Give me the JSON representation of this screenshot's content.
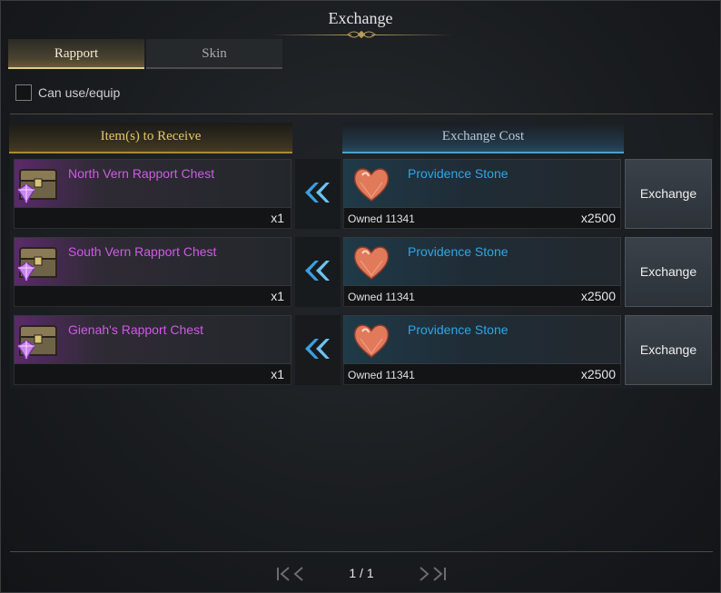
{
  "window": {
    "title": "Exchange"
  },
  "tabs": [
    {
      "label": "Rapport",
      "active": true
    },
    {
      "label": "Skin",
      "active": false
    }
  ],
  "filter": {
    "label": "Can use/equip",
    "checked": false
  },
  "columns": {
    "receive": "Item(s) to Receive",
    "cost": "Exchange Cost"
  },
  "rows": [
    {
      "receive": {
        "name": "North Vern Rapport Chest",
        "qty": "x1",
        "icon": "chest-icon"
      },
      "cost": {
        "name": "Providence Stone",
        "owned": "Owned 11341",
        "qty": "x2500",
        "icon": "heart-stone-icon"
      },
      "button": "Exchange"
    },
    {
      "receive": {
        "name": "South Vern Rapport Chest",
        "qty": "x1",
        "icon": "chest-icon"
      },
      "cost": {
        "name": "Providence Stone",
        "owned": "Owned 11341",
        "qty": "x2500",
        "icon": "heart-stone-icon"
      },
      "button": "Exchange"
    },
    {
      "receive": {
        "name": "Gienah's Rapport Chest",
        "qty": "x1",
        "icon": "chest-icon"
      },
      "cost": {
        "name": "Providence Stone",
        "owned": "Owned 11341",
        "qty": "x2500",
        "icon": "heart-stone-icon"
      },
      "button": "Exchange"
    }
  ],
  "pagination": {
    "label": "1 / 1"
  },
  "colors": {
    "item_name_purple": "#cf5ae6",
    "cost_name_blue": "#2fa6e6",
    "receive_header_gold": "#e7c668",
    "tab_active_underline": "#e2c98a"
  }
}
